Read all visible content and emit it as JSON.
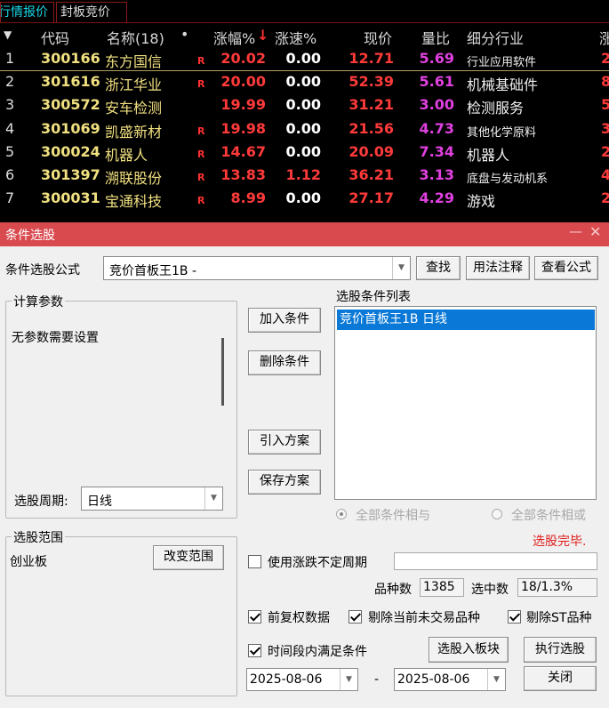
{
  "tabs": [
    "行情报价",
    "封板竞价"
  ],
  "header": {
    "code": "代码",
    "name": "名称(18)",
    "dot": "•",
    "pct": "涨幅%",
    "pct_sort": "↓",
    "speed": "涨速%",
    "price": "现价",
    "vol_ratio": "量比",
    "industry": "细分行业",
    "extra": "涨"
  },
  "rows": [
    {
      "idx": "1",
      "code": "300166",
      "name": "东方国信",
      "r": "R",
      "pct": "20.02",
      "speed": "0.00",
      "price": "12.71",
      "vol": "5.69",
      "industry": "行业应用软件",
      "last": "2"
    },
    {
      "idx": "2",
      "code": "301616",
      "name": "浙江华业",
      "r": "R",
      "pct": "20.00",
      "speed": "0.00",
      "price": "52.39",
      "vol": "5.61",
      "industry": "机械基础件",
      "last": "8"
    },
    {
      "idx": "3",
      "code": "300572",
      "name": "安车检测",
      "r": "",
      "pct": "19.99",
      "speed": "0.00",
      "price": "31.21",
      "vol": "3.00",
      "industry": "检测服务",
      "last": "5"
    },
    {
      "idx": "4",
      "code": "301069",
      "name": "凯盛新材",
      "r": "R",
      "pct": "19.98",
      "speed": "0.00",
      "price": "21.56",
      "vol": "4.73",
      "industry": "其他化学原料",
      "last": "3"
    },
    {
      "idx": "5",
      "code": "300024",
      "name": "机器人",
      "r": "R",
      "pct": "14.67",
      "speed": "0.00",
      "price": "20.09",
      "vol": "7.34",
      "industry": "机器人",
      "last": "2"
    },
    {
      "idx": "6",
      "code": "301397",
      "name": "溯联股份",
      "r": "R",
      "pct": "13.83",
      "speed": "1.12",
      "price": "36.21",
      "vol": "3.13",
      "industry": "底盘与发动机系",
      "last": "4"
    },
    {
      "idx": "7",
      "code": "300031",
      "name": "宝通科技",
      "r": "R",
      "pct": "8.99",
      "speed": "0.00",
      "price": "27.17",
      "vol": "4.29",
      "industry": "游戏",
      "last": "2"
    }
  ],
  "dialog": {
    "title": "条件选股",
    "formula_label": "条件选股公式",
    "formula_value": "竞价首板王1B  -",
    "find_button": "查找",
    "usage_button": "用法注释",
    "view_formula_button": "查看公式",
    "calc_params_title": "计算参数",
    "no_params_text": "无参数需要设置",
    "period_label": "选股周期:",
    "period_value": "日线",
    "add_condition": "加入条件",
    "delete_condition": "删除条件",
    "import_plan": "引入方案",
    "save_plan": "保存方案",
    "condition_list_title": "选股条件列表",
    "conditions": [
      "竞价首板王1B  日线"
    ],
    "radio_and": "全部条件相与",
    "radio_or": "全部条件相或",
    "status": "选股完毕.",
    "scope_title": "选股范围",
    "scope_value": "创业板",
    "change_scope": "改变范围",
    "use_uncertain_period": "使用涨跌不定周期",
    "count_label": "品种数",
    "count_value": "1385",
    "selected_label": "选中数",
    "selected_value": "18/1.3%",
    "pre_adjust": "前复权数据",
    "exclude_untraded": "剔除当前未交易品种",
    "exclude_st": "剔除ST品种",
    "time_range": "时间段内满足条件",
    "to_block": "选股入板块",
    "execute": "执行选股",
    "close": "关闭",
    "date_from": "2025-08-06",
    "date_sep": "-",
    "date_to": "2025-08-06",
    "minimize_icon": "—",
    "close_icon": "✕"
  },
  "colors": {
    "titlebar": "#d94a4f",
    "up_red": "#ff3a3a",
    "code_yellow": "#f0e080",
    "vol_magenta": "#e040e0",
    "tab_cyan": "#19d7e6",
    "list_selected": "#0a78d7"
  }
}
